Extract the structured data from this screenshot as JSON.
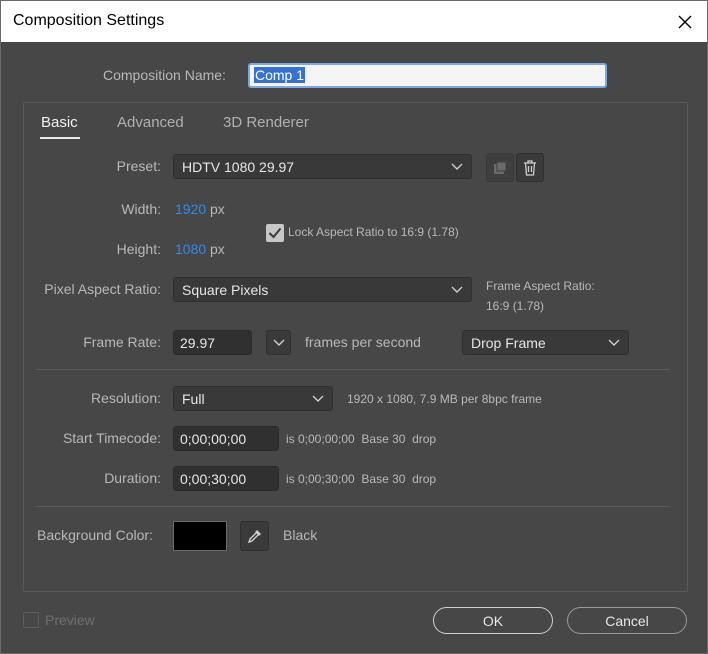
{
  "window": {
    "title": "Composition Settings"
  },
  "name": {
    "label": "Composition Name:",
    "value": "Comp 1"
  },
  "tabs": [
    {
      "label": "Basic"
    },
    {
      "label": "Advanced"
    },
    {
      "label": "3D Renderer"
    }
  ],
  "basic": {
    "preset_label": "Preset:",
    "preset_value": "HDTV 1080 29.97",
    "width_label": "Width:",
    "width_value": "1920",
    "height_label": "Height:",
    "height_value": "1080",
    "px_unit": "px",
    "lock_label": "Lock Aspect Ratio to 16:9 (1.78)",
    "lock_checked": true,
    "par_label": "Pixel Aspect Ratio:",
    "par_value": "Square Pixels",
    "far_label": "Frame Aspect Ratio:",
    "far_value": "16:9 (1.78)",
    "fps_label": "Frame Rate:",
    "fps_value": "29.97",
    "fps_unit": "frames per second",
    "drop_value": "Drop Frame",
    "res_label": "Resolution:",
    "res_value": "Full",
    "res_info": "1920 x 1080, 7.9 MB per 8bpc frame",
    "start_label": "Start Timecode:",
    "start_value": "0;00;00;00",
    "start_info": "is 0;00;00;00  Base 30  drop",
    "dur_label": "Duration:",
    "dur_value": "0;00;30;00",
    "dur_info": "is 0;00;30;00  Base 30  drop",
    "bg_label": "Background Color:",
    "bg_name": "Black",
    "bg_color": "#000000"
  },
  "footer": {
    "preview_label": "Preview",
    "ok_label": "OK",
    "cancel_label": "Cancel"
  },
  "colors": {
    "accent": "#2d8ceb",
    "background": "#474747",
    "selection": "#3572d6"
  }
}
